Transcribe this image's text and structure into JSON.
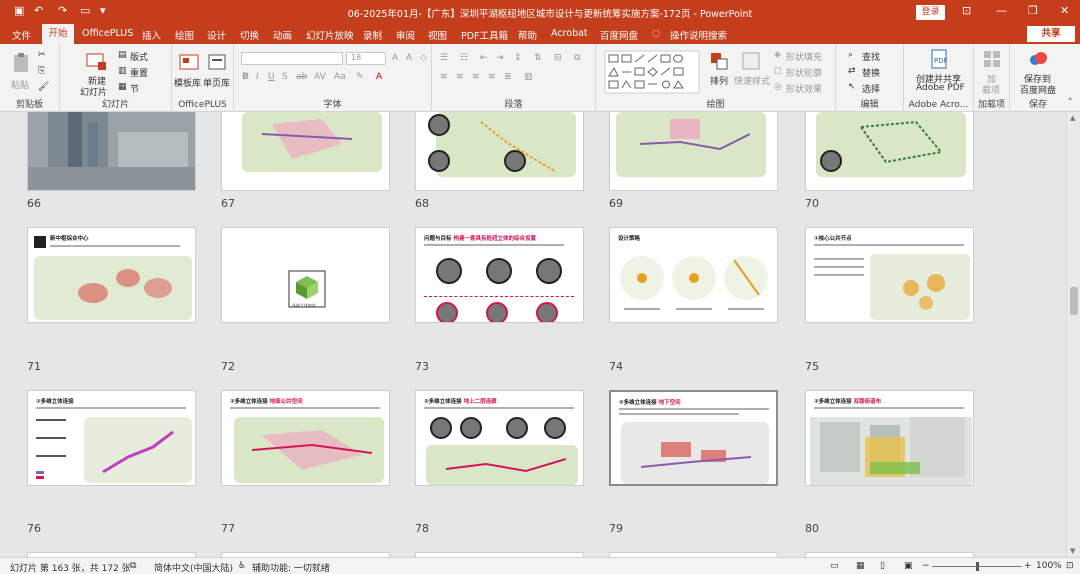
{
  "window": {
    "title": "06-2025年01月-【广东】深圳平湖枢纽地区城市设计与更新统筹实施方案-172页  -  PowerPoint",
    "login_label": "登录"
  },
  "quick_access": [
    "save-icon",
    "undo-icon",
    "redo-icon",
    "present-icon",
    "customize-icon"
  ],
  "menu": {
    "items": [
      "文件",
      "开始",
      "OfficePLUS",
      "插入",
      "绘图",
      "设计",
      "切换",
      "动画",
      "幻灯片放映",
      "录制",
      "审阅",
      "视图",
      "PDF工具箱",
      "帮助",
      "Acrobat",
      "百度网盘",
      "操作说明搜索"
    ],
    "active": "开始",
    "share_label": "共享"
  },
  "ribbon": {
    "clipboard": {
      "label": "剪贴板",
      "paste": "粘贴"
    },
    "slides": {
      "label": "幻灯片",
      "new_slide": "新建",
      "new_slide2": "幻灯片",
      "layout": "版式",
      "reset": "重置",
      "section": "节"
    },
    "officeplus": {
      "label": "OfficePLUS",
      "template": "模板库",
      "single": "单页库"
    },
    "font": {
      "label": "字体",
      "size": "18"
    },
    "paragraph": {
      "label": "段落"
    },
    "drawing": {
      "label": "绘图",
      "arrange": "排列",
      "quick_style": "快速样式",
      "fill": "形状填充",
      "outline": "形状轮廓",
      "effect": "形状效果"
    },
    "editing": {
      "label": "编辑",
      "find": "查找",
      "replace": "替换",
      "select": "选择"
    },
    "adobe": {
      "label": "Adobe Acro...",
      "create1": "创建并共享",
      "create2": "Adobe PDF"
    },
    "addins": {
      "label": "加载项",
      "add1": "加",
      "add2": "载项"
    },
    "save": {
      "label": "保存",
      "save1": "保存到",
      "save2": "百度网盘"
    }
  },
  "slides": {
    "rows": [
      [
        {
          "num": "66"
        },
        {
          "num": "67"
        },
        {
          "num": "68"
        },
        {
          "num": "69"
        },
        {
          "num": "70"
        }
      ],
      [
        {
          "num": "71",
          "title": "新中枢综合中心"
        },
        {
          "num": "72"
        },
        {
          "num": "73",
          "title": "问题与目标",
          "title_hl": "构建一套具有枢纽立体的综合设置"
        },
        {
          "num": "74",
          "title": "设计策略"
        },
        {
          "num": "75",
          "title": "①核心公共节点"
        }
      ],
      [
        {
          "num": "76",
          "title": "②多维立体连接"
        },
        {
          "num": "77",
          "title": "②多维立体连接",
          "title_hl": "地面公共空间"
        },
        {
          "num": "78",
          "title": "②多维立体连接",
          "title_hl": "地上二层连廊"
        },
        {
          "num": "79",
          "title": "②多维立体连接",
          "title_hl": "地下空间"
        },
        {
          "num": "80",
          "title": "②多维立体连接",
          "title_hl": "双路街道布"
        }
      ]
    ],
    "selected": "79",
    "slide72_caption": "多维立体构架"
  },
  "status": {
    "slide_info": "幻灯片 第 163 张，共 172 张",
    "language": "简体中文(中国大陆)",
    "accessibility": "辅助功能: 一切就绪",
    "zoom": "100%"
  },
  "colors": {
    "accent": "#c43e1c",
    "highlight": "#d4145a"
  }
}
